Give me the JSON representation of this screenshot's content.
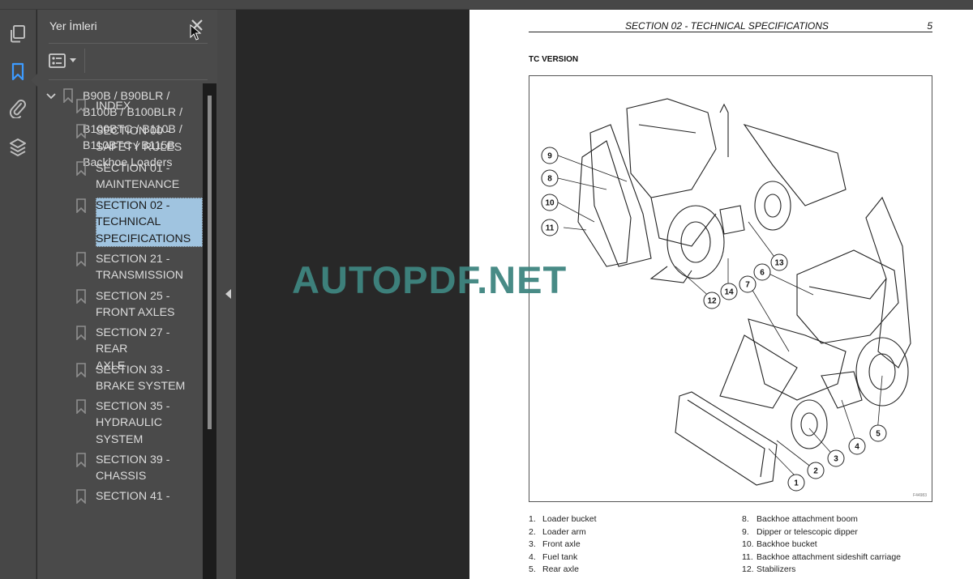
{
  "toolbar_rail": {
    "items": [
      {
        "name": "pages",
        "icon": "pages-icon"
      },
      {
        "name": "bookmarks",
        "icon": "bookmark-icon",
        "active": true
      },
      {
        "name": "attachments",
        "icon": "paperclip-icon"
      },
      {
        "name": "layers",
        "icon": "layers-icon"
      }
    ],
    "accent_color": "#3d9bff"
  },
  "bookmarks_panel": {
    "title": "Yer İmleri",
    "close_icon": "close-icon",
    "options_icon": "list-options-icon",
    "root": {
      "label": "B90B / B90BLR /\nB100B / B100BLR /\nB100BTC / B110B /\nB110BTC / B115B\nBackhoe Loaders",
      "expanded": true
    },
    "items": [
      {
        "label": "INDEX"
      },
      {
        "label": "SECTION 00 -\nSAFETY RULES"
      },
      {
        "label": "SECTION 01 -\nMAINTENANCE"
      },
      {
        "label": "SECTION 02 -\nTECHNICAL\nSPECIFICATIONS",
        "selected": true
      },
      {
        "label": "SECTION 21 -\nTRANSMISSION"
      },
      {
        "label": "SECTION 25 -\nFRONT AXLES"
      },
      {
        "label": "SECTION 27 - REAR\nAXLE"
      },
      {
        "label": "SECTION 33 -\nBRAKE SYSTEM"
      },
      {
        "label": "SECTION 35 -\nHYDRAULIC\nSYSTEM"
      },
      {
        "label": "SECTION 39 -\nCHASSIS"
      },
      {
        "label": "SECTION 41 -"
      }
    ],
    "selected_color": "#a0c4e0"
  },
  "document": {
    "header_section": "SECTION 02 - TECHNICAL SPECIFICATIONS",
    "page_number": "5",
    "subtitle": "TC VERSION",
    "figure_id": "F44983",
    "callouts": [
      "1",
      "2",
      "3",
      "4",
      "5",
      "6",
      "7",
      "8",
      "9",
      "10",
      "11",
      "12",
      "13",
      "14"
    ],
    "legend_left": [
      {
        "n": "1.",
        "t": "Loader bucket"
      },
      {
        "n": "2.",
        "t": "Loader arm"
      },
      {
        "n": "3.",
        "t": "Front axle"
      },
      {
        "n": "4.",
        "t": "Fuel tank"
      },
      {
        "n": "5.",
        "t": "Rear axle"
      }
    ],
    "legend_right": [
      {
        "n": "8.",
        "t": "Backhoe attachment boom"
      },
      {
        "n": "9.",
        "t": "Dipper or telescopic dipper"
      },
      {
        "n": "10.",
        "t": "Backhoe bucket"
      },
      {
        "n": "11.",
        "t": "Backhoe attachment sideshift carriage"
      },
      {
        "n": "12.",
        "t": "Stabilizers"
      }
    ]
  },
  "watermark": {
    "text": "AUTOPDF.NET",
    "color": "#3f8580"
  }
}
